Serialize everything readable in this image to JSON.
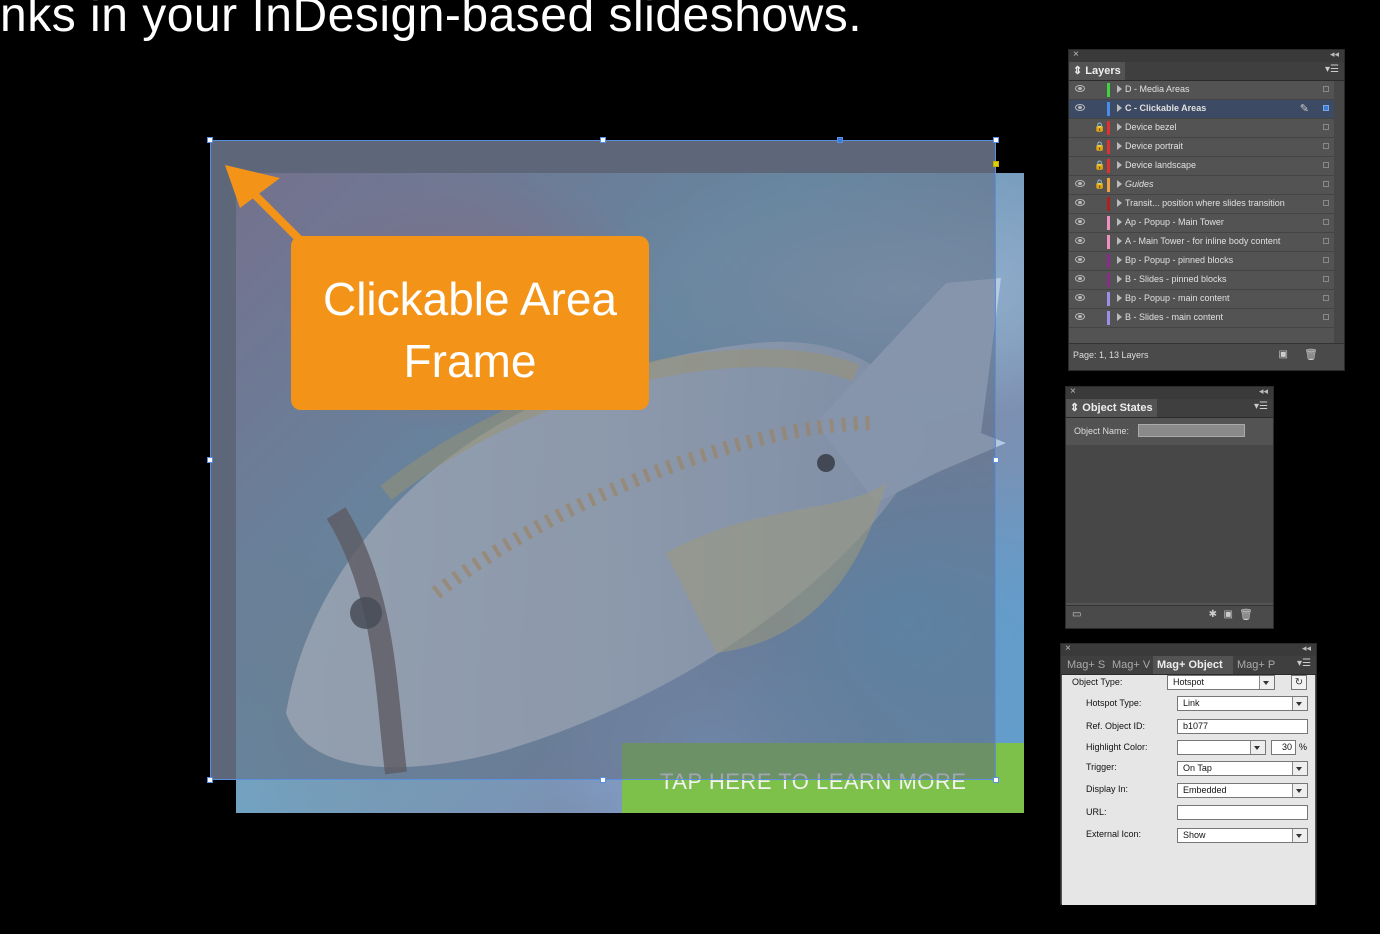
{
  "headline": "nks in your InDesign-based slideshows.",
  "slide": {
    "cta_label": "TAP HERE TO LEARN MORE",
    "cta_color": "#7dc04a"
  },
  "callout": {
    "line1": "Clickable Area",
    "line2": "Frame",
    "color": "#f39419"
  },
  "layers_panel": {
    "tab": "Layers",
    "footer": "Page: 1, 13 Layers",
    "layers": [
      {
        "name": "D - Media Areas",
        "color": "#3fd33f",
        "visible": true,
        "locked": false
      },
      {
        "name": "C - Clickable Areas",
        "color": "#4a8de8",
        "visible": true,
        "locked": false,
        "selected": true
      },
      {
        "name": "Device bezel",
        "color": "#e03030",
        "visible": false,
        "locked": true
      },
      {
        "name": "Device portrait",
        "color": "#e03030",
        "visible": false,
        "locked": true
      },
      {
        "name": "Device landscape",
        "color": "#e03030",
        "visible": false,
        "locked": true
      },
      {
        "name": "Guides",
        "color": "#f0a040",
        "visible": true,
        "locked": true
      },
      {
        "name": "Transit... position where slides transition",
        "color": "#b02020",
        "visible": true,
        "locked": false
      },
      {
        "name": "Ap - Popup - Main Tower",
        "color": "#ee90c0",
        "visible": true,
        "locked": false
      },
      {
        "name": "A - Main Tower - for inline body content",
        "color": "#ee90c0",
        "visible": true,
        "locked": false
      },
      {
        "name": "Bp - Popup - pinned blocks",
        "color": "#8a2c8a",
        "visible": true,
        "locked": false
      },
      {
        "name": "B - Slides - pinned blocks",
        "color": "#8a2c8a",
        "visible": true,
        "locked": false
      },
      {
        "name": "Bp - Popup - main content",
        "color": "#9a90e8",
        "visible": true,
        "locked": false
      },
      {
        "name": "B - Slides - main content",
        "color": "#9a90e8",
        "visible": true,
        "locked": false
      }
    ]
  },
  "object_states_panel": {
    "tab": "Object States",
    "object_name_label": "Object Name:"
  },
  "mag_panel": {
    "tabs": [
      "Mag+ S",
      "Mag+ V",
      "Mag+ Object",
      "Mag+ P"
    ],
    "object_type_label": "Object Type:",
    "object_type_value": "Hotspot",
    "hotspot_type_label": "Hotspot Type:",
    "hotspot_type_value": "Link",
    "ref_object_label": "Ref. Object ID:",
    "ref_object_value": "b1077",
    "highlight_label": "Highlight Color:",
    "highlight_value": "",
    "highlight_pct": "30",
    "pct_sign": "%",
    "trigger_label": "Trigger:",
    "trigger_value": "On Tap",
    "display_label": "Display In:",
    "display_value": "Embedded",
    "url_label": "URL:",
    "url_value": "",
    "external_icon_label": "External Icon:",
    "external_icon_value": "Show"
  }
}
